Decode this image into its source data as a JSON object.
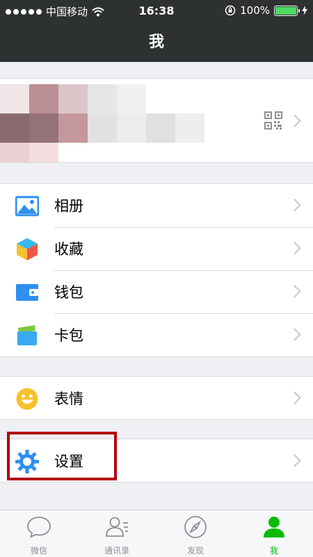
{
  "status_bar": {
    "carrier": "中国移动",
    "time": "16:38",
    "battery": "100%"
  },
  "navbar": {
    "title": "我"
  },
  "menu": {
    "group1": [
      {
        "label": "相册",
        "icon": "album-icon"
      },
      {
        "label": "收藏",
        "icon": "favorites-icon"
      },
      {
        "label": "钱包",
        "icon": "wallet-icon"
      },
      {
        "label": "卡包",
        "icon": "card-package-icon"
      }
    ],
    "group2": [
      {
        "label": "表情",
        "icon": "sticker-icon"
      }
    ],
    "group3": [
      {
        "label": "设置",
        "icon": "settings-icon"
      }
    ]
  },
  "tabs": [
    {
      "label": "微信",
      "icon": "chat-icon",
      "active": false
    },
    {
      "label": "通讯录",
      "icon": "contacts-icon",
      "active": false
    },
    {
      "label": "发现",
      "icon": "discover-icon",
      "active": false
    },
    {
      "label": "我",
      "icon": "me-icon",
      "active": true
    }
  ],
  "colors": {
    "accent": "#09bb07",
    "navbar_bg": "#2e3132",
    "highlight": "#b3000e"
  }
}
